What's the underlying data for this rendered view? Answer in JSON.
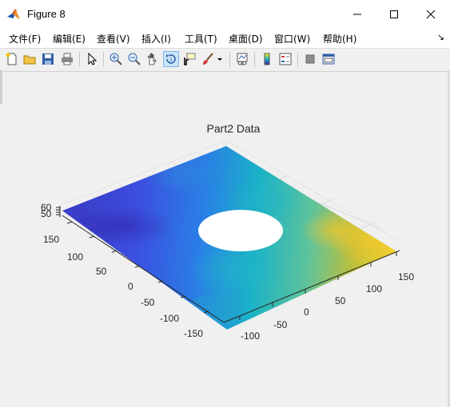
{
  "window": {
    "title": "Figure 8",
    "app_icon": "matlab-icon"
  },
  "menus": [
    "文件(F)",
    "编辑(E)",
    "查看(V)",
    "插入(I)",
    "工具(T)",
    "桌面(D)",
    "窗口(W)",
    "帮助(H)"
  ],
  "toolbar_icons": [
    "new-figure-icon",
    "open-file-icon",
    "save-icon",
    "print-icon",
    "edit-plot-arrow-icon",
    "zoom-in-icon",
    "zoom-out-icon",
    "pan-hand-icon",
    "rotate-3d-icon",
    "data-cursor-icon",
    "brush-icon",
    "brush-dropdown-icon",
    "link-plot-icon",
    "colorbar-icon",
    "legend-icon",
    "hide-plot-tools-icon",
    "show-plot-tools-icon"
  ],
  "active_tool": "rotate-3d-icon",
  "chart_data": {
    "type": "surface3d",
    "title": "Part2 Data",
    "xlabel": "",
    "ylabel": "",
    "zlabel": "",
    "x_ticks": [
      -100,
      -50,
      0,
      50,
      100,
      150
    ],
    "y_ticks": [
      -150,
      -100,
      -50,
      0,
      50,
      100,
      150
    ],
    "z_ticks": [
      50,
      60
    ],
    "xlim": [
      -150,
      150
    ],
    "ylim": [
      -150,
      150
    ],
    "zlim": [
      50,
      60
    ],
    "hole": {
      "shape": "circle",
      "center": [
        0,
        0
      ],
      "radius": 40
    },
    "colormap": "parula",
    "color_gradient": "low values blue (far-left) to high values yellow (right)",
    "grid": true,
    "background": "#f0f0f0"
  }
}
